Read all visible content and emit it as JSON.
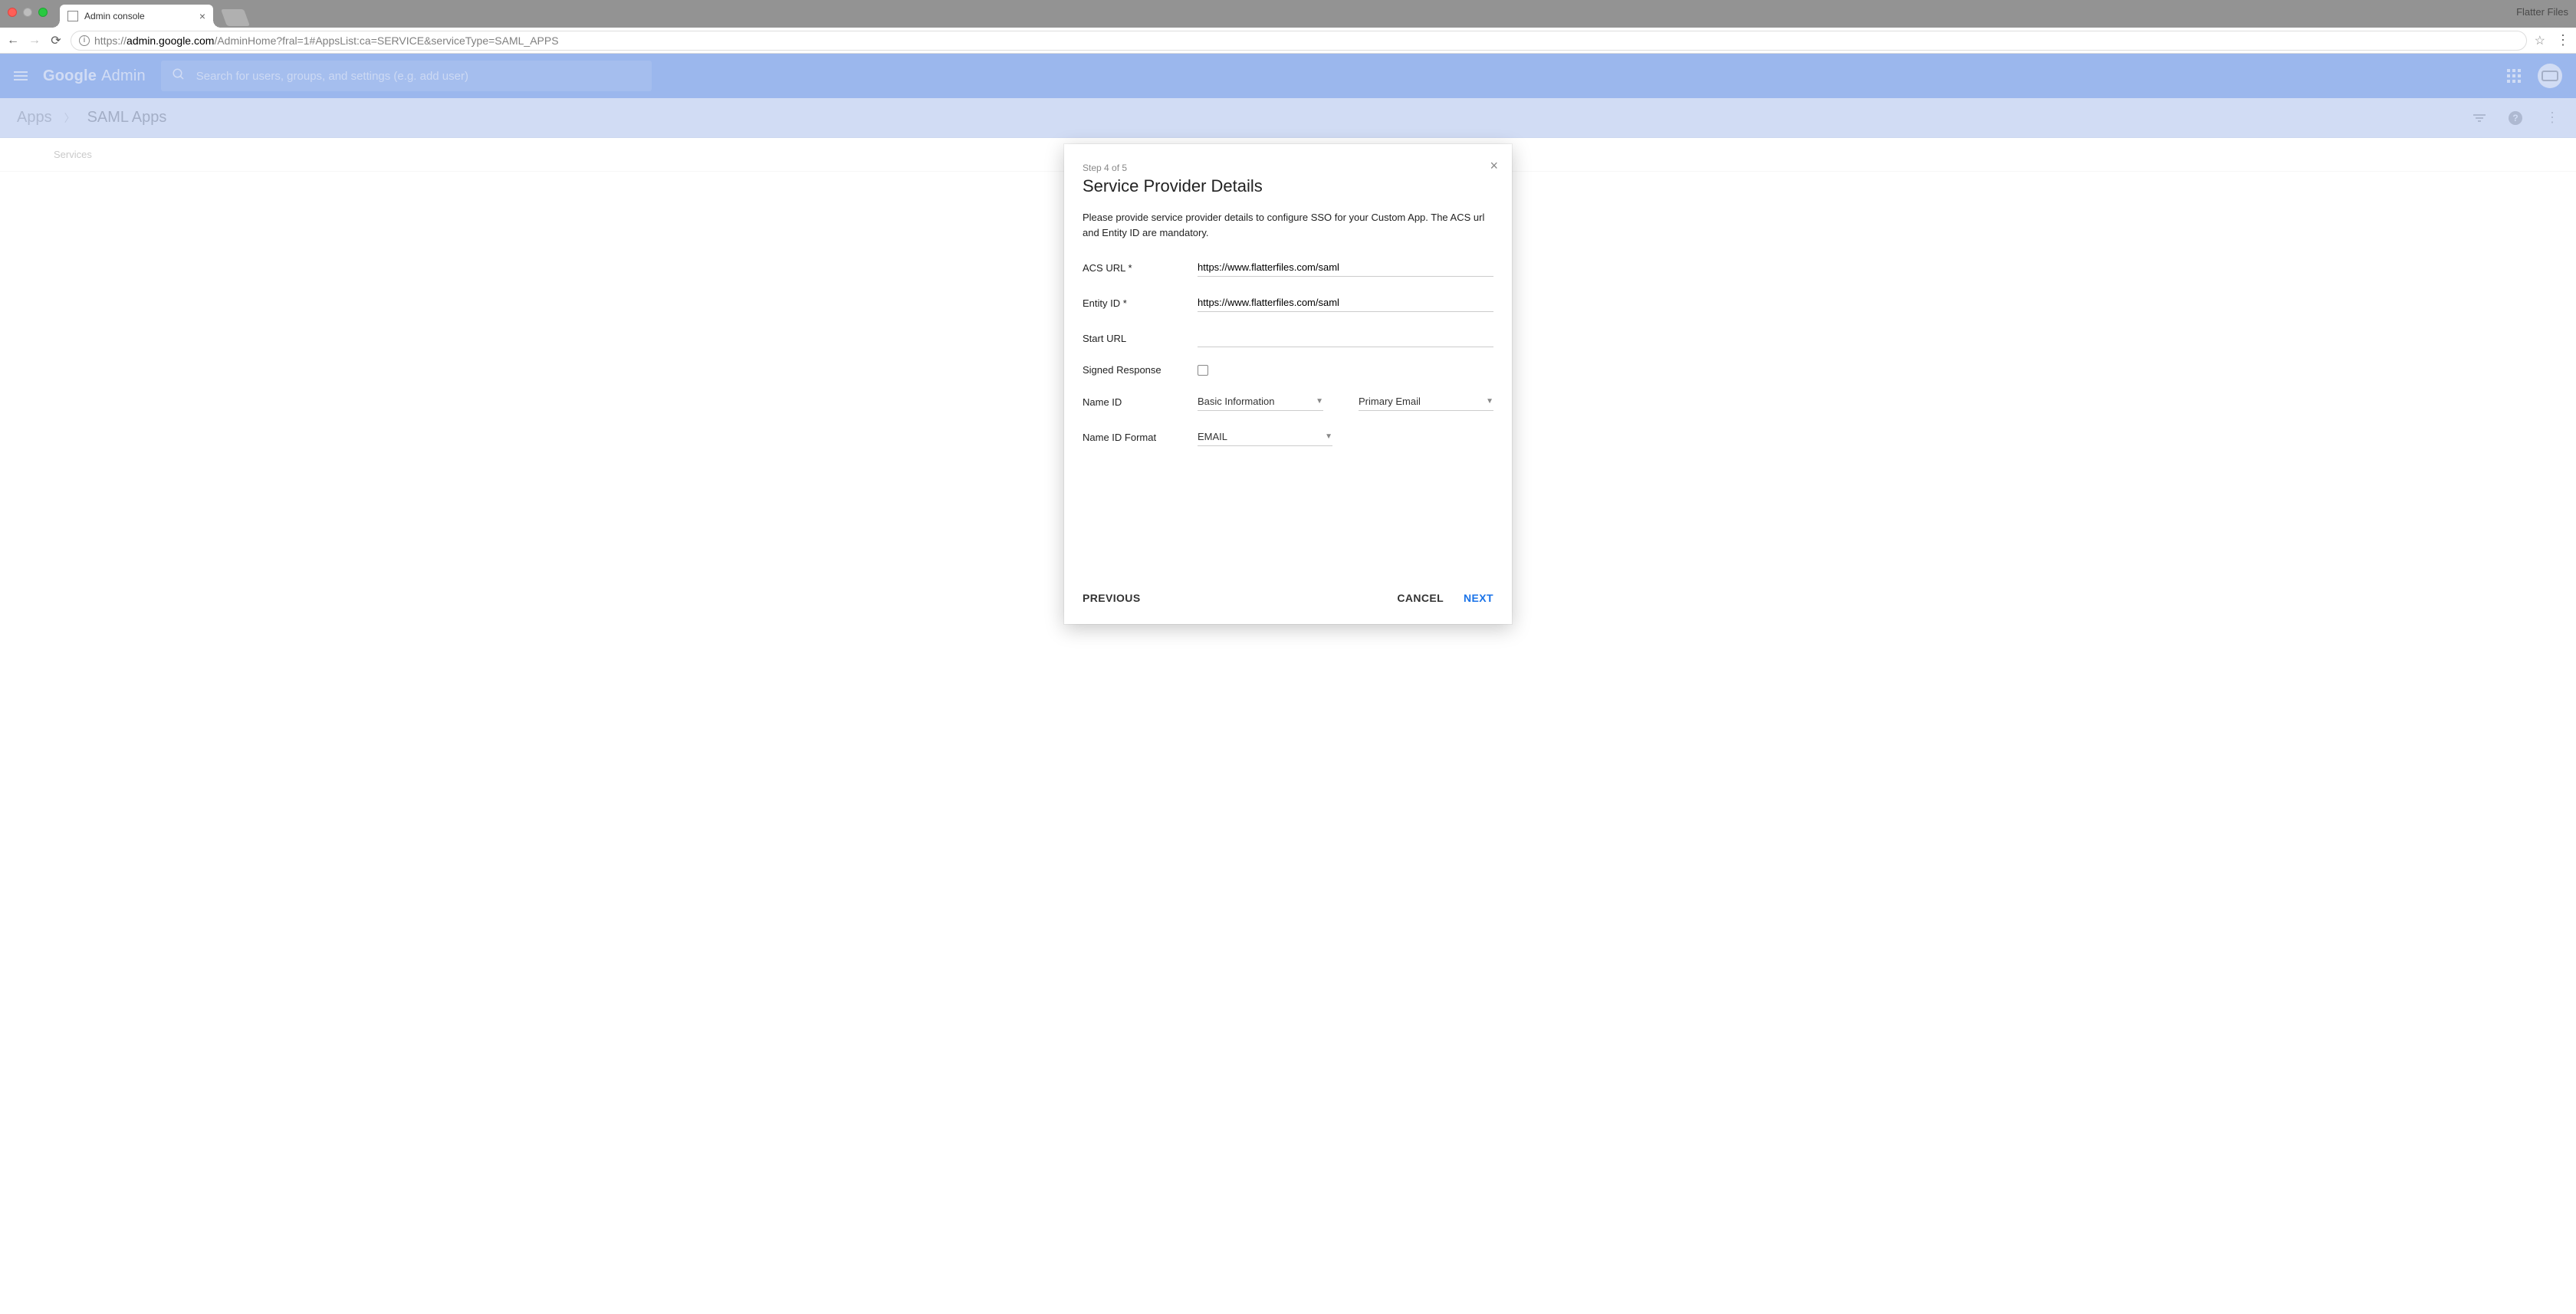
{
  "browser": {
    "tab_title": "Admin console",
    "menubar_app": "Flatter Files",
    "url_prefix": "https://",
    "url_host": "admin.google.com",
    "url_path": "/AdminHome?fral=1#AppsList:ca=SERVICE&serviceType=SAML_APPS"
  },
  "header": {
    "logo_google": "Google",
    "logo_admin": "Admin",
    "search_placeholder": "Search for users, groups, and settings (e.g. add user)"
  },
  "breadcrumb": {
    "crumb1": "Apps",
    "crumb2": "SAML Apps"
  },
  "subheader": {
    "services": "Services"
  },
  "modal": {
    "step": "Step 4 of 5",
    "title": "Service Provider Details",
    "desc": "Please provide service provider details to configure SSO for your Custom App. The ACS url and Entity ID are mandatory.",
    "labels": {
      "acs": "ACS URL *",
      "entity": "Entity ID *",
      "start": "Start URL",
      "signed": "Signed Response",
      "nameid": "Name ID",
      "nameidformat": "Name ID Format"
    },
    "values": {
      "acs": "https://www.flatterfiles.com/saml",
      "entity": "https://www.flatterfiles.com/saml",
      "start": "",
      "nameid_cat": "Basic Information",
      "nameid_attr": "Primary Email",
      "nameidformat": "EMAIL"
    },
    "buttons": {
      "previous": "PREVIOUS",
      "cancel": "CANCEL",
      "next": "NEXT"
    }
  }
}
